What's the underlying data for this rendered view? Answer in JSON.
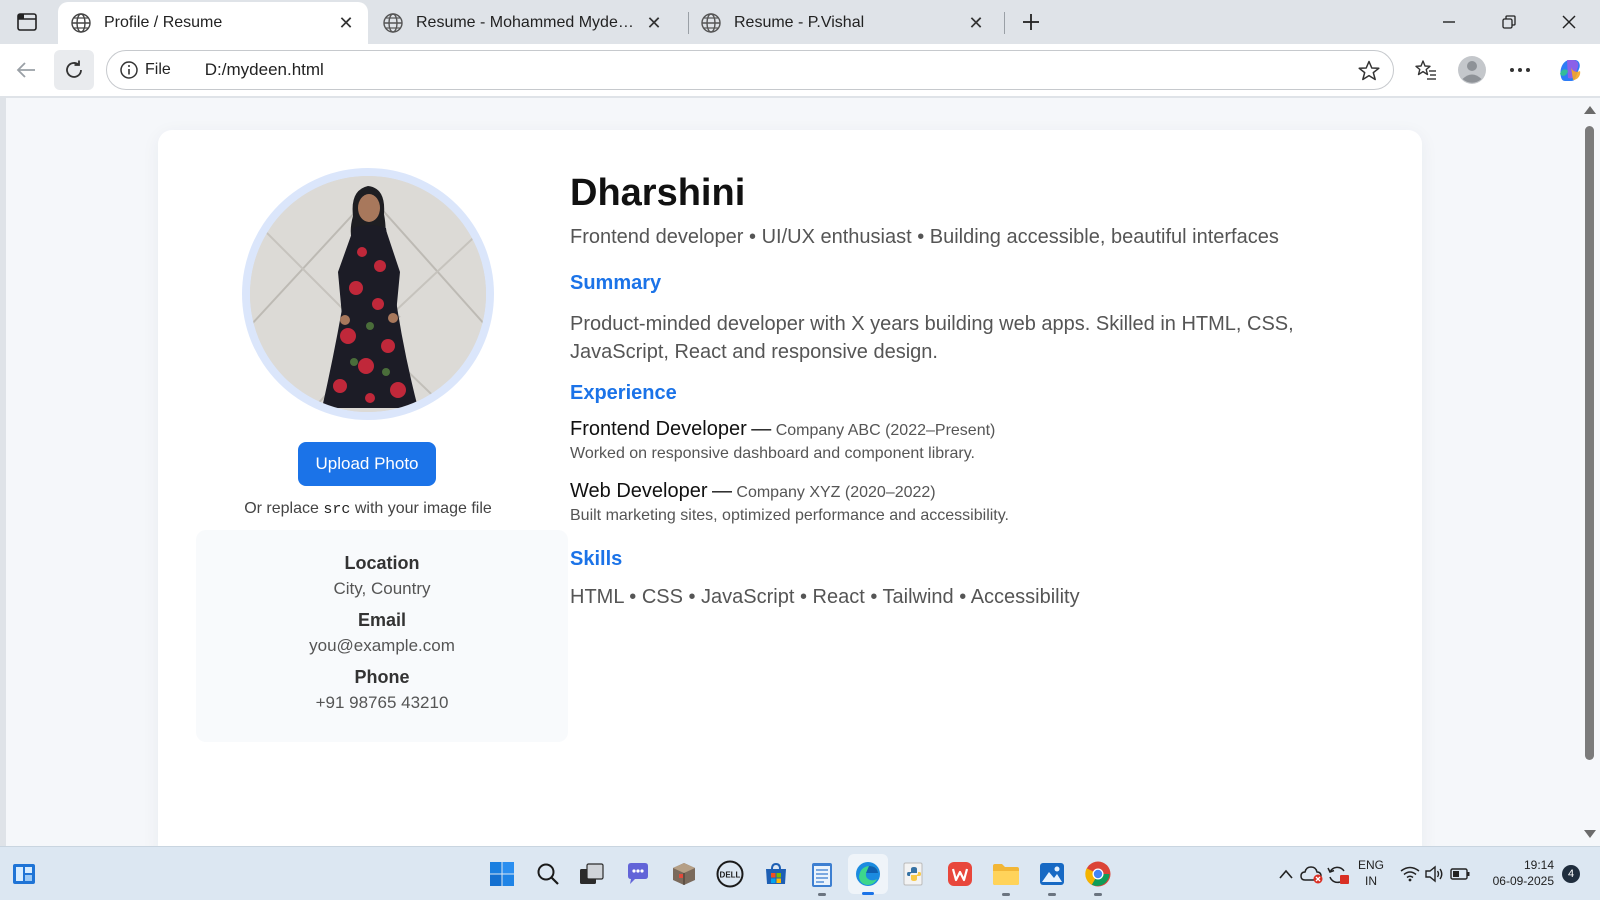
{
  "browser": {
    "tabs": [
      {
        "title": "Profile / Resume",
        "active": true
      },
      {
        "title": "Resume - Mohammed Mydeen.A",
        "active": false
      },
      {
        "title": "Resume - P.Vishal",
        "active": false
      }
    ],
    "address": {
      "scheme_label": "File",
      "url": "D:/mydeen.html"
    }
  },
  "profile": {
    "name": "Dharshini",
    "tagline": "Frontend developer • UI/UX enthusiast • Building accessible, beautiful interfaces",
    "upload_label": "Upload Photo",
    "hint_prefix": "Or replace",
    "hint_code": "src",
    "hint_suffix": "with your image file",
    "contact": {
      "location_label": "Location",
      "location_value": "City, Country",
      "email_label": "Email",
      "email_value": "you@example.com",
      "phone_label": "Phone",
      "phone_value": "+91 98765 43210"
    },
    "summary_title": "Summary",
    "summary": "Product-minded developer with X years building web apps. Skilled in HTML, CSS, JavaScript, React and responsive design.",
    "experience_title": "Experience",
    "experience": [
      {
        "role": "Frontend Developer",
        "separator": "—",
        "company": "Company ABC (2022–Present)",
        "description": "Worked on responsive dashboard and component library."
      },
      {
        "role": "Web Developer",
        "separator": "—",
        "company": "Company XYZ (2020–2022)",
        "description": "Built marketing sites, optimized performance and accessibility."
      }
    ],
    "skills_title": "Skills",
    "skills": "HTML • CSS • JavaScript • React • Tailwind • Accessibility"
  },
  "taskbar": {
    "lang_top": "ENG",
    "lang_bottom": "IN",
    "time": "19:14",
    "date": "06-09-2025",
    "notification_count": "4"
  },
  "colors": {
    "accent": "#1b73e8",
    "page_bg": "#f5f7fa",
    "card_bg": "#ffffff"
  }
}
